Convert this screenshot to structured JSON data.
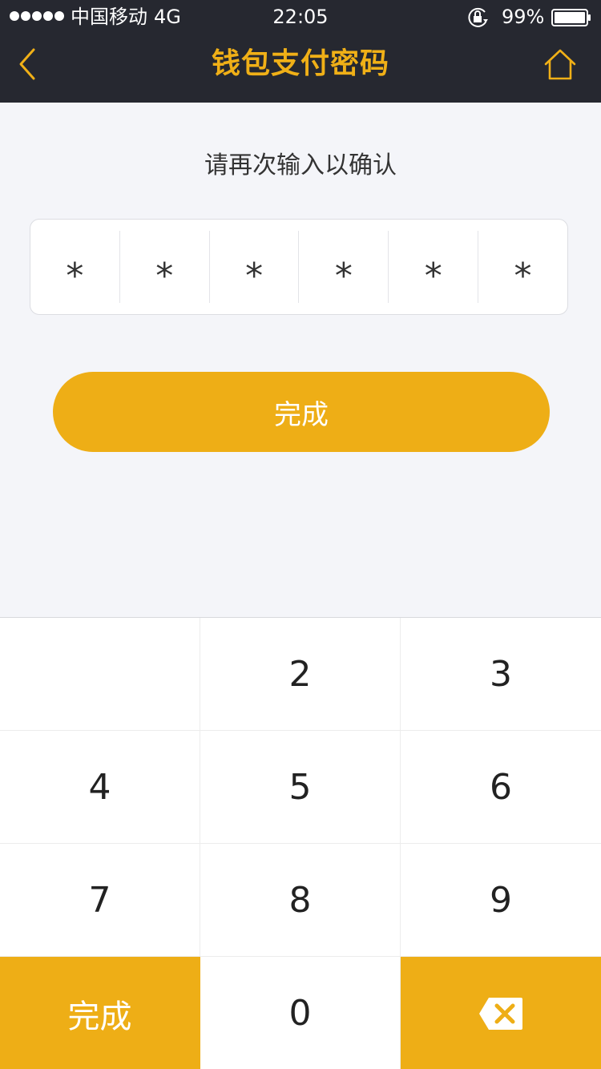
{
  "status_bar": {
    "carrier": "中国移动",
    "network": "4G",
    "time": "22:05",
    "battery_percent": "99%",
    "signal_bars": 5,
    "icons": [
      "signal-icon",
      "orientation-lock-icon",
      "battery-icon"
    ]
  },
  "nav": {
    "title": "钱包支付密码",
    "back_icon": "chevron-left-icon",
    "home_icon": "home-icon"
  },
  "prompt": "请再次输入以确认",
  "pin": {
    "digits": [
      "*",
      "*",
      "*",
      "*",
      "*",
      "*"
    ]
  },
  "done_button": "完成",
  "keypad": {
    "keys": [
      {
        "label": "",
        "type": "blank"
      },
      {
        "label": "2",
        "type": "digit"
      },
      {
        "label": "3",
        "type": "digit"
      },
      {
        "label": "4",
        "type": "digit"
      },
      {
        "label": "5",
        "type": "digit"
      },
      {
        "label": "6",
        "type": "digit"
      },
      {
        "label": "7",
        "type": "digit"
      },
      {
        "label": "8",
        "type": "digit"
      },
      {
        "label": "9",
        "type": "digit"
      },
      {
        "label": "完成",
        "type": "done"
      },
      {
        "label": "0",
        "type": "digit"
      },
      {
        "label": "",
        "type": "backspace",
        "icon": "backspace-icon"
      }
    ]
  },
  "colors": {
    "accent": "#eeae16",
    "header_bg": "#262830",
    "page_bg": "#f4f5f9"
  }
}
